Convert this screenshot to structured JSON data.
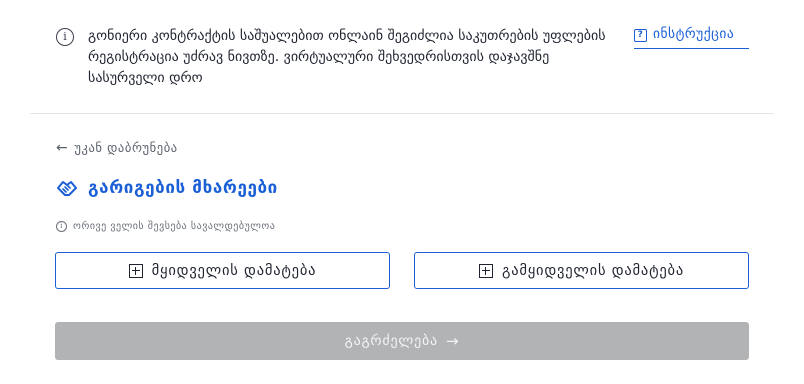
{
  "banner": {
    "text": "გონიერი კონტრაქტის საშუალებით ონლაინ შეგიძლია საკუთრების უფლების რეგისტრაცია უძრავ ნივთზე. ვირტუალური შეხვედრისთვის დაჯავშნე სასურველი დრო",
    "instruction_label": "ინსტრუქცია",
    "info_icon": "info-circle-icon",
    "instruction_icon": "question-box-icon"
  },
  "back": {
    "label": "უკან დაბრუნება",
    "arrow": "←"
  },
  "section": {
    "title": "გარიგების მხარეები",
    "icon": "handshake-icon"
  },
  "note": {
    "text": "ორივე ველის შევსება სავალდებულოა"
  },
  "buttons": {
    "add_buyer": "მყიდველის დამატება",
    "add_seller": "გამყიდველის დამატება",
    "continue": "გაგრძელება",
    "continue_arrow": "→"
  },
  "colors": {
    "accent": "#1a5fd6",
    "disabled_bg": "#b2b3b5"
  }
}
